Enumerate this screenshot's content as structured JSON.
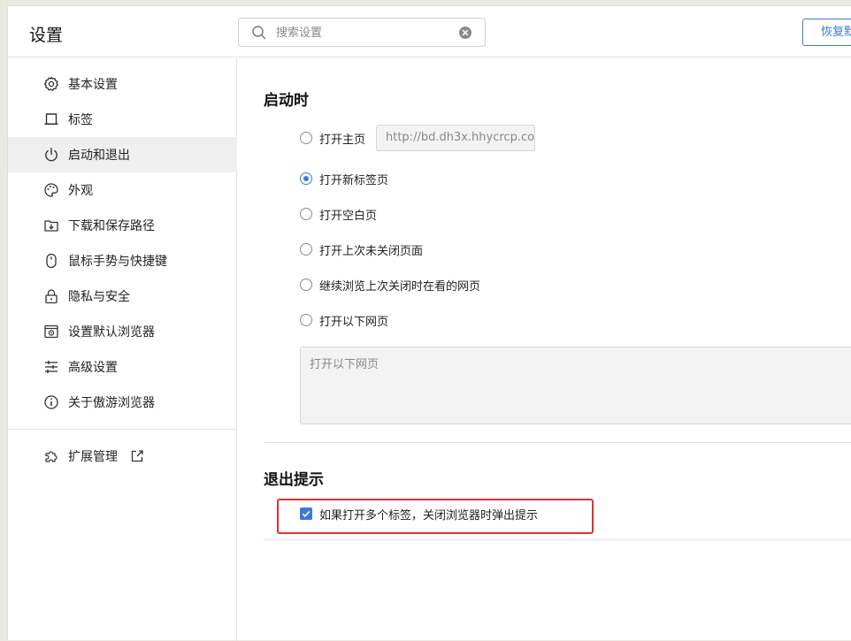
{
  "header": {
    "title": "设置",
    "search": {
      "placeholder": "搜索设置",
      "value": ""
    },
    "restore_button": "恢复默认设置"
  },
  "sidebar": {
    "items": [
      {
        "label": "基本设置",
        "icon": "gear-icon"
      },
      {
        "label": "标签",
        "icon": "tab-icon"
      },
      {
        "label": "启动和退出",
        "icon": "power-icon",
        "active": true
      },
      {
        "label": "外观",
        "icon": "palette-icon"
      },
      {
        "label": "下载和保存路径",
        "icon": "download-icon"
      },
      {
        "label": "鼠标手势与快捷键",
        "icon": "mouse-icon"
      },
      {
        "label": "隐私与安全",
        "icon": "lock-icon"
      },
      {
        "label": "设置默认浏览器",
        "icon": "default-browser-icon"
      },
      {
        "label": "高级设置",
        "icon": "sliders-icon"
      },
      {
        "label": "关于傲游浏览器",
        "icon": "info-icon"
      }
    ],
    "extensions": {
      "label": "扩展管理",
      "icon": "puzzle-icon"
    }
  },
  "startup": {
    "title": "启动时",
    "options": [
      {
        "label": "打开主页",
        "checked": false
      },
      {
        "label": "打开新标签页",
        "checked": true
      },
      {
        "label": "打开空白页",
        "checked": false
      },
      {
        "label": "打开上次未关闭页面",
        "checked": false
      },
      {
        "label": "继续浏览上次关闭时在看的网页",
        "checked": false
      },
      {
        "label": "打开以下网页",
        "checked": false
      }
    ],
    "homepage_url": "http://bd.dh3x.hhycrcp.co",
    "pages_placeholder": "打开以下网页"
  },
  "exit": {
    "title": "退出提示",
    "checkbox_label": "如果打开多个标签，关闭浏览器时弹出提示",
    "checked": true
  },
  "colors": {
    "accent": "#3b7ad9",
    "highlight": "#e0312f"
  }
}
